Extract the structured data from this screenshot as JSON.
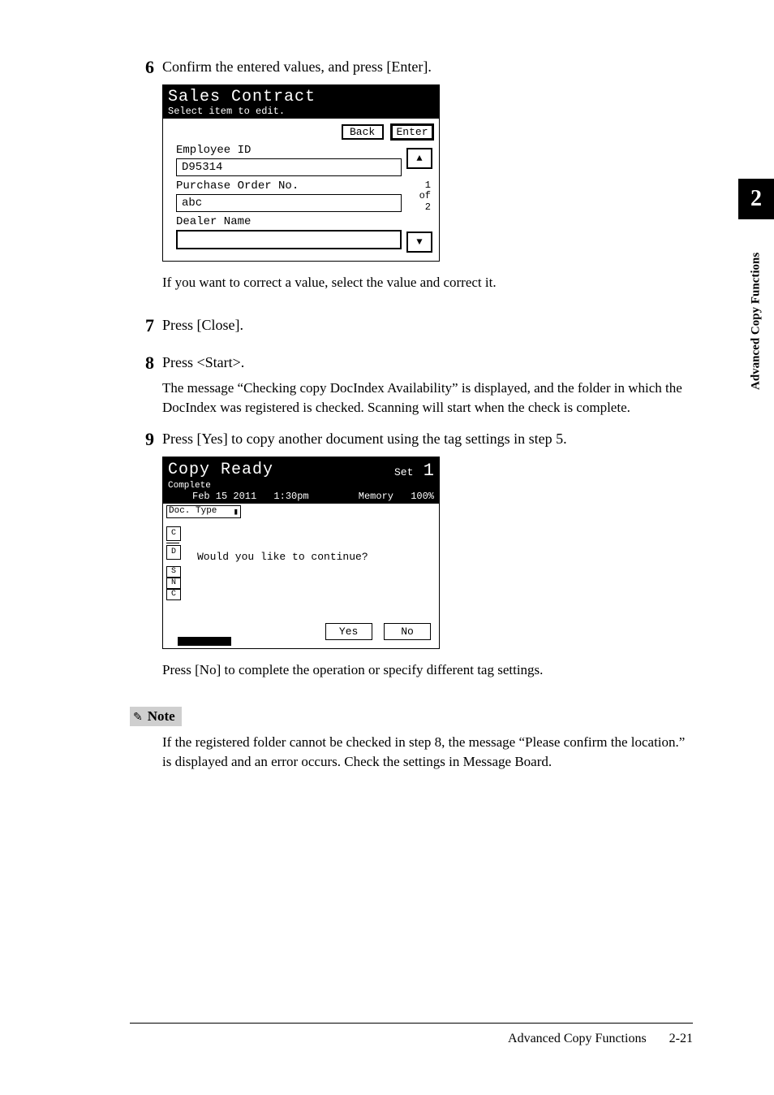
{
  "side": {
    "chapter": "2",
    "label": "Advanced Copy Functions"
  },
  "steps": {
    "s6": {
      "text": "Confirm the entered values, and press [Enter].",
      "after": "If you want to correct a value, select the value and correct it."
    },
    "s7": {
      "text": "Press [Close]."
    },
    "s8": {
      "text": "Press <Start>.",
      "after": "The message “Checking copy DocIndex Availability” is displayed, and the folder in which the DocIndex was registered is checked. Scanning will start when the check is complete."
    },
    "s9": {
      "text": "Press [Yes] to copy another document using the tag settings in step 5.",
      "after": "Press [No] to complete the operation or specify different tag settings."
    }
  },
  "lcd1": {
    "title": "Sales Contract",
    "subtitle": "Select item to edit.",
    "back": "Back",
    "enter": "Enter",
    "fields": {
      "empId_label": "Employee ID",
      "empId_value": "D95314",
      "po_label": "Purchase Order No.",
      "po_value": "abc",
      "dealer_label": "Dealer Name",
      "dealer_value": ""
    },
    "page": {
      "cur": "1",
      "of": "of",
      "total": "2"
    },
    "arrow_up": "▲",
    "arrow_down": "▼"
  },
  "lcd2": {
    "title": "Copy Ready",
    "complete": "Complete",
    "date": "Feb 15 2011",
    "time": "1:30pm",
    "set_label": "Set",
    "set_num": "1",
    "memory_label": "Memory",
    "memory_pct": "100%",
    "doc_type": "Doc. Type",
    "side": {
      "c": "C",
      "d": "D",
      "s": "S",
      "n": "N",
      "c2": "C"
    },
    "prompt": "Would you like to continue?",
    "yes": "Yes",
    "no": "No"
  },
  "note": {
    "label": "Note",
    "text": "If the registered folder cannot be checked in step 8, the message “Please confirm the location.” is displayed and an error occurs. Check the settings in Message Board."
  },
  "footer": {
    "section": "Advanced Copy Functions",
    "page": "2-21"
  },
  "nums": {
    "n6": "6",
    "n7": "7",
    "n8": "8",
    "n9": "9"
  }
}
